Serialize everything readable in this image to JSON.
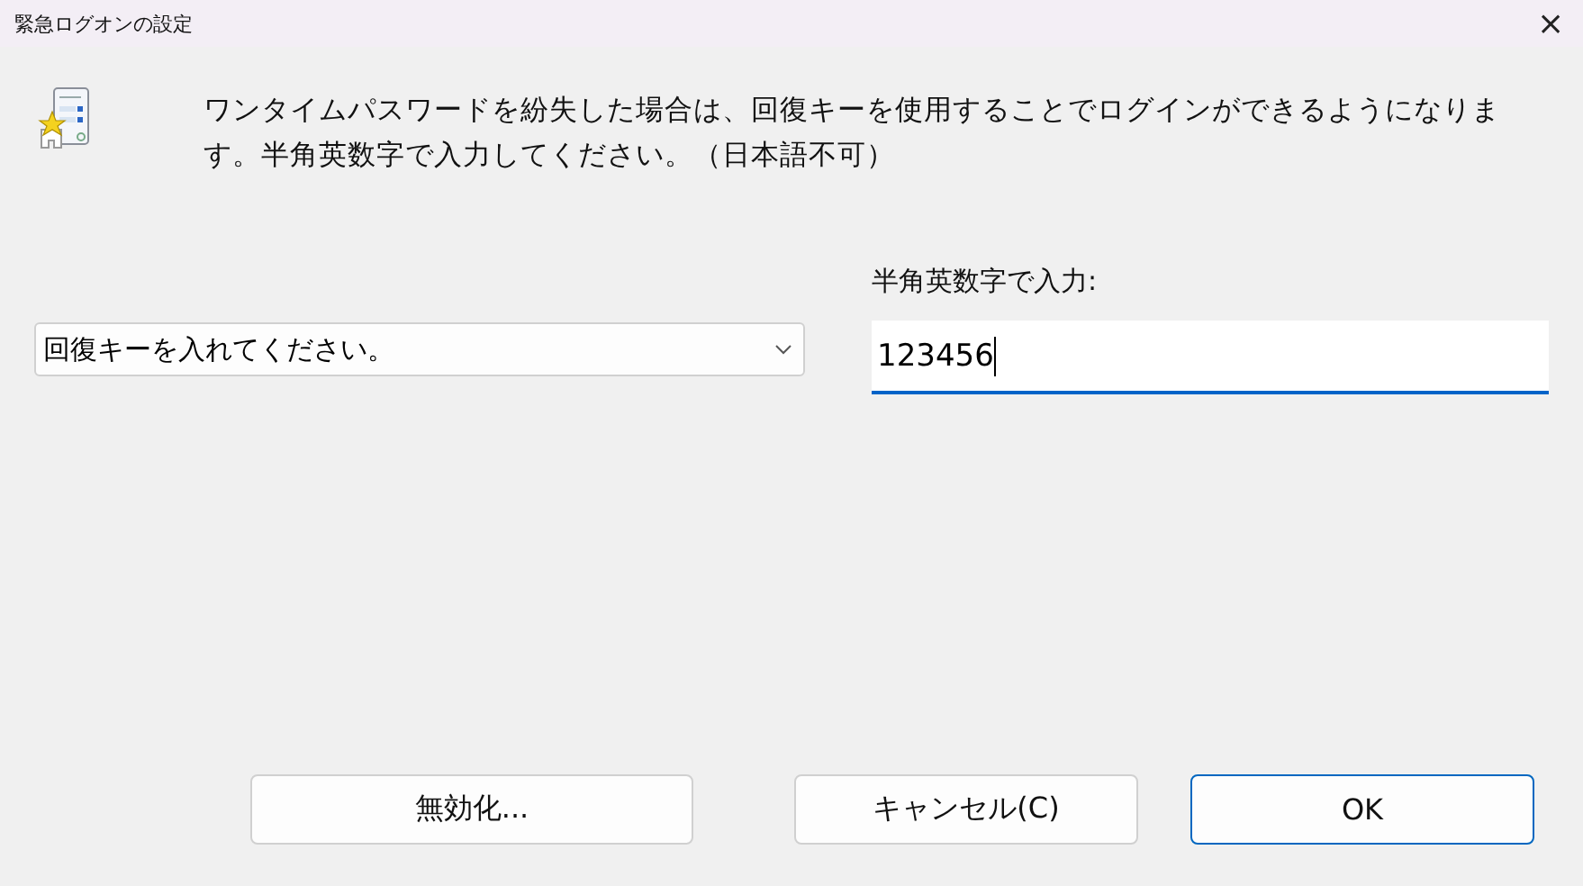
{
  "window": {
    "title": "緊急ログオンの設定",
    "close": "×"
  },
  "message": "ワンタイムパスワードを紛失した場合は、回復キーを使用することでログインができるようになります。半角英数字で入力してください。（日本語不可）",
  "dropdown": {
    "value": "回復キーを入れてください。"
  },
  "input": {
    "label": "半角英数字で入力:",
    "value": "123456",
    "focused": true
  },
  "buttons": [
    {
      "label": "無効化...",
      "default": false
    },
    {
      "label": "キャンセル(C)",
      "default": false
    },
    {
      "label": "OK",
      "default": true
    }
  ]
}
